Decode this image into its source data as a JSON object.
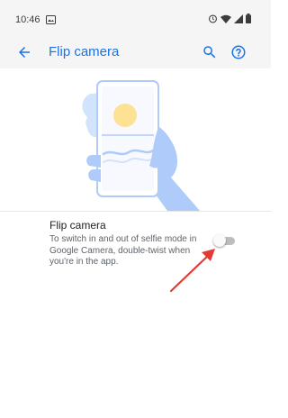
{
  "status_bar": {
    "time": "10:46",
    "icons": [
      "notification-icon",
      "alarm-icon",
      "wifi-icon",
      "signal-icon",
      "battery-icon"
    ]
  },
  "app_bar": {
    "title": "Flip camera",
    "icons": [
      "back-arrow-icon",
      "search-icon",
      "help-icon"
    ]
  },
  "setting": {
    "title": "Flip camera",
    "description": "To switch in and out of selfie mode in Google Camera, double-twist when you're in the app.",
    "toggle_on": false
  },
  "colors": {
    "accent": "#1a73e8",
    "arrow": "#e53935",
    "illustration_blue": "#aecbfa",
    "sun": "#fde293"
  }
}
